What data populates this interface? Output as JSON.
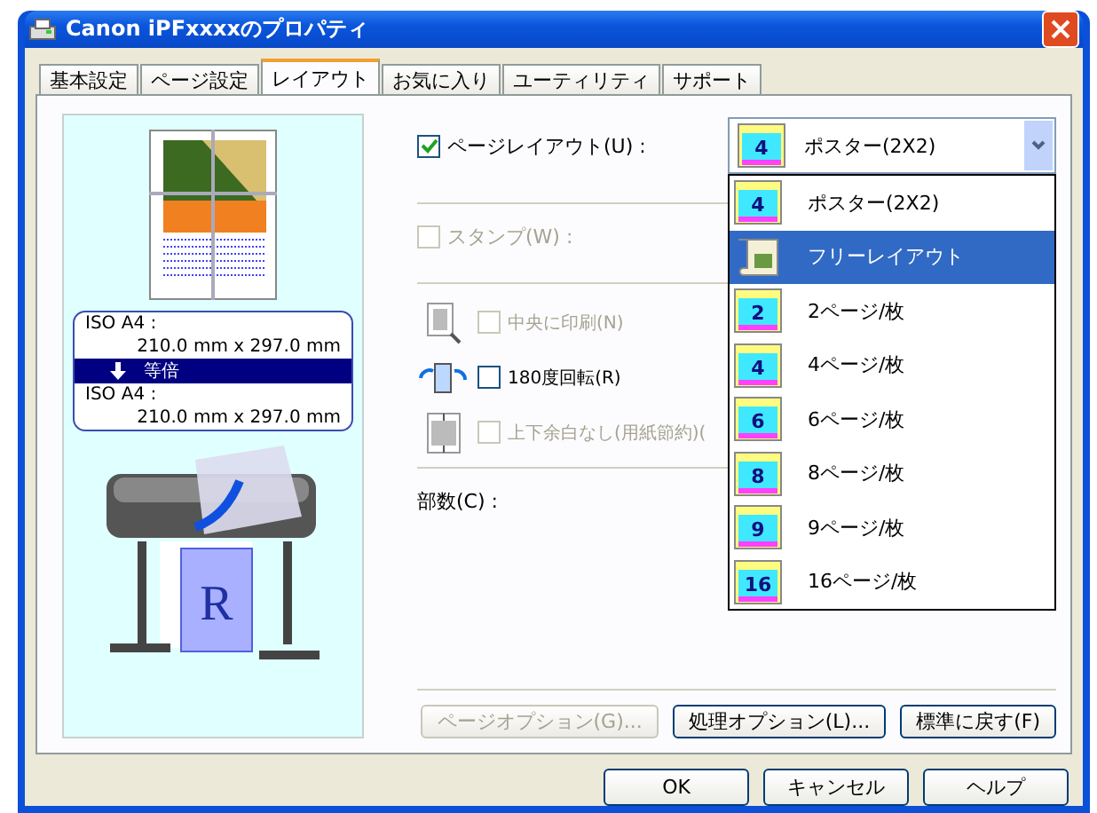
{
  "window": {
    "title": "Canon iPFxxxxのプロパティ"
  },
  "tabs": [
    {
      "label": "基本設定",
      "selected": false
    },
    {
      "label": "ページ設定",
      "selected": false
    },
    {
      "label": "レイアウト",
      "selected": true
    },
    {
      "label": "お気に入り",
      "selected": false
    },
    {
      "label": "ユーティリティ",
      "selected": false
    },
    {
      "label": "サポート",
      "selected": false
    }
  ],
  "preview": {
    "input_size_label": "ISO A4 :",
    "input_size": "210.0 mm x 297.0 mm",
    "scaling": "等倍",
    "output_size_label": "ISO A4 :",
    "output_size": "210.0 mm x 297.0 mm",
    "print_sample": "R"
  },
  "page_layout": {
    "label": "ページレイアウト(U) :",
    "checked": true,
    "value": "ポスター(2X2)",
    "value_icon_label": "4"
  },
  "layout_options": [
    {
      "label": "ポスター(2X2)",
      "kind": "grid",
      "icon_label": "4",
      "selected": false
    },
    {
      "label": "フリーレイアウト",
      "kind": "scroll",
      "selected": true
    },
    {
      "label": "2ページ/枚",
      "kind": "grid",
      "icon_label": "2",
      "selected": false
    },
    {
      "label": "4ページ/枚",
      "kind": "grid",
      "icon_label": "4",
      "selected": false
    },
    {
      "label": "6ページ/枚",
      "kind": "grid",
      "icon_label": "6",
      "selected": false
    },
    {
      "label": "8ページ/枚",
      "kind": "grid",
      "icon_label": "8",
      "selected": false
    },
    {
      "label": "9ページ/枚",
      "kind": "grid",
      "icon_label": "9",
      "selected": false
    },
    {
      "label": "16ページ/枚",
      "kind": "grid",
      "icon_label": "16",
      "selected": false
    }
  ],
  "stamp": {
    "label": "スタンプ(W) :",
    "checked": false,
    "disabled": true
  },
  "options": [
    {
      "label": "中央に印刷(N)",
      "checked": false,
      "disabled": true
    },
    {
      "label": "180度回転(R)",
      "checked": false,
      "disabled": false
    },
    {
      "label": "上下余白なし(用紙節約)(",
      "checked": false,
      "disabled": true
    }
  ],
  "copies": {
    "label": "部数(C) :"
  },
  "panel_buttons": [
    {
      "label": "ページオプション(G)...",
      "disabled": true
    },
    {
      "label": "処理オプション(L)...",
      "disabled": false
    },
    {
      "label": "標準に戻す(F)",
      "disabled": false
    }
  ],
  "dialog_buttons": [
    {
      "label": "OK"
    },
    {
      "label": "キャンセル"
    },
    {
      "label": "ヘルプ"
    }
  ]
}
